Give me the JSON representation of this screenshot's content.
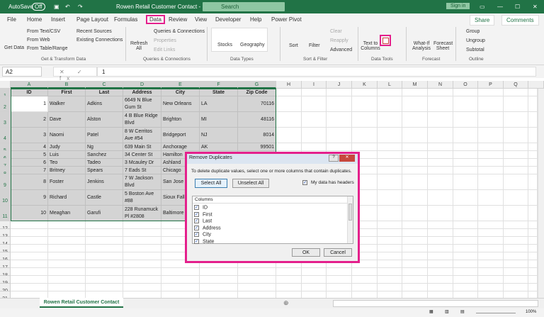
{
  "titlebar": {
    "autosave": "AutoSave",
    "autosave_state": "Off",
    "title": "Rowen Retail Customer Contact - Ex...",
    "search": "Search",
    "sign_in": "Sign in"
  },
  "menu": {
    "tabs": [
      "File",
      "Home",
      "Insert",
      "Page Layout",
      "Formulas",
      "Data",
      "Review",
      "View",
      "Developer",
      "Help",
      "Power Pivot"
    ],
    "active": "Data",
    "share": "Share",
    "comments": "Comments"
  },
  "ribbon": {
    "get_data": "Get Data",
    "from_text": "From Text/CSV",
    "from_web": "From Web",
    "from_table": "From Table/Range",
    "recent_sources": "Recent Sources",
    "existing_connections": "Existing Connections",
    "group_get": "Get & Transform Data",
    "refresh_all": "Refresh All",
    "queries": "Queries & Connections",
    "properties": "Properties",
    "edit_links": "Edit Links",
    "group_queries": "Queries & Connections",
    "stocks": "Stocks",
    "geography": "Geography",
    "group_types": "Data Types",
    "sort": "Sort",
    "filter": "Filter",
    "clear": "Clear",
    "reapply": "Reapply",
    "advanced": "Advanced",
    "group_sort": "Sort & Filter",
    "text_to_columns": "Text to Columns",
    "group_tools": "Data Tools",
    "what_if": "What-If Analysis",
    "forecast_sheet": "Forecast Sheet",
    "group_forecast": "Forecast",
    "group": "Group",
    "ungroup": "Ungroup",
    "subtotal": "Subtotal",
    "group_outline": "Outline"
  },
  "highlight_color": "#e4208c",
  "formula": {
    "name_box": "A2",
    "fx": "✕ ✓ fx",
    "value": "1"
  },
  "columns": [
    "A",
    "B",
    "C",
    "D",
    "E",
    "F",
    "G",
    "H",
    "I",
    "J",
    "K",
    "L",
    "M",
    "N",
    "O",
    "P",
    "Q"
  ],
  "rows": [
    "1",
    "2",
    "3",
    "4",
    "5",
    "6",
    "7",
    "8",
    "9",
    "10",
    "11",
    "12",
    "13",
    "14",
    "15",
    "16",
    "17",
    "18",
    "19",
    "20",
    "21"
  ],
  "table": {
    "headers": [
      "ID",
      "First",
      "Last",
      "Address",
      "City",
      "State",
      "Zip Code"
    ],
    "data": [
      [
        "1",
        "Walker",
        "Adkins",
        "6649 N Blue Gum St",
        "New Orleans",
        "LA",
        "70116"
      ],
      [
        "2",
        "Dave",
        "Alston",
        "4 B Blue Ridge Blvd",
        "Brighton",
        "MI",
        "48116"
      ],
      [
        "3",
        "Naomi",
        "Patel",
        "8 W Cerritos Ave #54",
        "Bridgeport",
        "NJ",
        "8014"
      ],
      [
        "4",
        "Judy",
        "Ng",
        "639 Main St",
        "Anchorage",
        "AK",
        "99501"
      ],
      [
        "5",
        "Luis",
        "Sanchez",
        "34 Center St",
        "Hamilton",
        "",
        ""
      ],
      [
        "6",
        "Teo",
        "Tadeo",
        "3 Mcauley Dr",
        "Ashland",
        "",
        ""
      ],
      [
        "7",
        "Britney",
        "Spears",
        "7 Eads St",
        "Chicago",
        "",
        ""
      ],
      [
        "8",
        "Foster",
        "Jenkins",
        "7 W Jackson Blvd",
        "San Jose",
        "",
        ""
      ],
      [
        "9",
        "Richard",
        "Castle",
        "5 Boston Ave #88",
        "Sioux Falls",
        "",
        ""
      ],
      [
        "10",
        "Meaghan",
        "Garufi",
        "228 Runamuck Pl #2808",
        "Baltimore",
        "",
        ""
      ]
    ]
  },
  "dialog": {
    "title": "Remove Duplicates",
    "help": "?",
    "close": "✕",
    "instructions": "To delete duplicate values, select one or more columns that contain duplicates.",
    "select_all": "Select All",
    "unselect_all": "Unselect All",
    "has_headers": "My data has headers",
    "has_headers_checked": true,
    "columns_header": "Columns",
    "columns": [
      "ID",
      "First",
      "Last",
      "Address",
      "City",
      "State"
    ],
    "ok": "OK",
    "cancel": "Cancel"
  },
  "sheet": {
    "tab": "Rowen Retail Customer Contact",
    "zoom": "100%"
  }
}
